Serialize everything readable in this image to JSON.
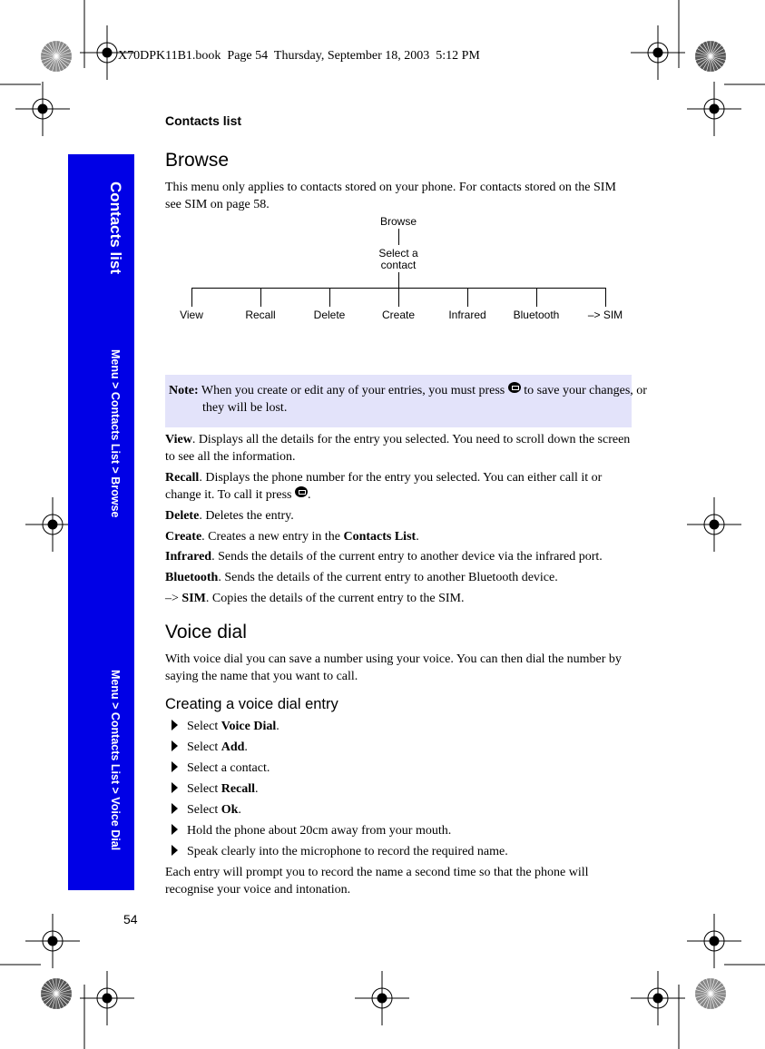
{
  "print_header": "X70DPK11B1.book  Page 54  Thursday, September 18, 2003  5:12 PM",
  "running_head": "Contacts list",
  "sidebar": {
    "color": "#0000e6",
    "title": "Contacts list",
    "path1": "Menu > Contacts List > Browse",
    "path2": "Menu > Contacts List > Voice Dial"
  },
  "browse": {
    "heading": "Browse",
    "intro": "This menu only applies to contacts stored on your phone. For contacts stored on the SIM see SIM on page 58.",
    "diagram": {
      "root": "Browse",
      "child_line1": "Select a",
      "child_line2": "contact",
      "leaves": [
        "View",
        "Recall",
        "Delete",
        "Create",
        "Infrared",
        "Bluetooth",
        "–> SIM"
      ]
    },
    "note": {
      "label": "Note:",
      "text_before": " When you create or edit any of your entries, you must press ",
      "key_icon": "save-key-icon",
      "text_after": " to save your changes, or they will be lost."
    },
    "items": [
      {
        "term": "View",
        "text": ". Displays all the details for the entry you selected. You need to scroll down the screen to see all the information."
      },
      {
        "term": "Recall",
        "text": ". Displays the phone number for the entry you selected. You can either call it or change it. To call it press ",
        "text_after": "."
      },
      {
        "term": "Delete",
        "text": ". Deletes the entry."
      },
      {
        "term": "Create",
        "text": ". Creates a new entry in the ",
        "bold2": "Contacts List",
        "text_after": "."
      },
      {
        "term": "Infrared",
        "text": ". Sends the details of the current entry to another device via the infrared port."
      },
      {
        "term": "Bluetooth",
        "text": ". Sends the details of the current entry to another Bluetooth device."
      },
      {
        "prefix": "–> ",
        "term": "SIM",
        "text": ". Copies the details of the current entry to the SIM."
      }
    ]
  },
  "voice_dial": {
    "heading": "Voice dial",
    "intro": "With voice dial you can save a number using your voice. You can then dial the number by saying the name that you want to call.",
    "subheading": "Creating a voice dial entry",
    "steps": [
      {
        "text": "Select ",
        "bold": "Voice Dial",
        "end": "."
      },
      {
        "text": "Select ",
        "bold": "Add",
        "end": "."
      },
      {
        "text": "Select a contact.",
        "bold": "",
        "end": ""
      },
      {
        "text": "Select ",
        "bold": "Recall",
        "end": "."
      },
      {
        "text": "Select ",
        "bold": "Ok",
        "end": "."
      },
      {
        "text": "Hold the phone about 20cm away from your mouth.",
        "bold": "",
        "end": ""
      },
      {
        "text": "Speak clearly into the microphone to record the required name.",
        "bold": "",
        "end": ""
      }
    ],
    "outro": "Each entry will prompt you to record the name a second time so that the phone will recognise your voice and intonation."
  },
  "page_number": "54"
}
